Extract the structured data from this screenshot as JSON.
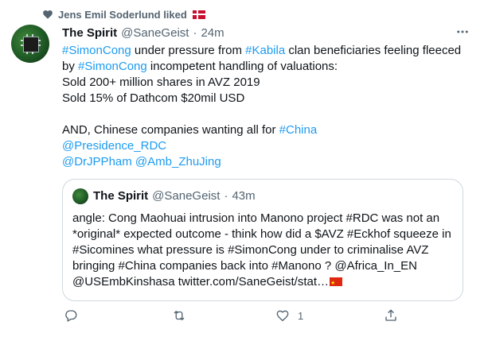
{
  "social_context": {
    "text": "Jens Emil Soderlund  liked",
    "flag": "denmark-flag"
  },
  "tweet": {
    "author_name": "The Spirit",
    "handle": "@SaneGeist",
    "separator": "·",
    "time": "24m",
    "lines": [
      [
        {
          "t": "#SimonCong",
          "k": "hashtag"
        },
        {
          "t": " under pressure from ",
          "k": "text"
        },
        {
          "t": "#Kabila",
          "k": "hashtag"
        },
        {
          "t": " clan beneficiaries feeling fleeced",
          "k": "text"
        }
      ],
      [
        {
          "t": "by ",
          "k": "text"
        },
        {
          "t": "#SimonCong",
          "k": "hashtag"
        },
        {
          "t": " incompetent handling of valuations:",
          "k": "text"
        }
      ],
      [
        {
          "t": "Sold 200+ million shares in AVZ 2019",
          "k": "text"
        }
      ],
      [
        {
          "t": "Sold 15% of Dathcom $20mil USD",
          "k": "text"
        }
      ],
      [
        {
          "t": "",
          "k": "text"
        }
      ],
      [
        {
          "t": "AND, Chinese companies wanting all for ",
          "k": "text"
        },
        {
          "t": "#China",
          "k": "hashtag"
        }
      ],
      [
        {
          "t": "@Presidence_RDC",
          "k": "mention"
        }
      ],
      [
        {
          "t": "@DrJPPham",
          "k": "mention"
        },
        {
          "t": " ",
          "k": "text"
        },
        {
          "t": "@Amb_ZhuJing",
          "k": "mention"
        }
      ]
    ]
  },
  "quote": {
    "author_name": "The Spirit",
    "handle": "@SaneGeist",
    "separator": "·",
    "time": "43m",
    "lines": [
      "angle: Cong Maohuai intrusion into Manono project #RDC was not an",
      "*original* expected outcome - think how did a $AVZ #Eckhof squeeze in",
      "#Sicomines what pressure is #SimonCong under to criminalise AVZ",
      "bringing #China  companies back into #Manono  ?  @Africa_In_EN",
      "@USEmbKinshasa twitter.com/SaneGeist/stat…"
    ],
    "trailing_flag": "china-flag"
  },
  "actions": {
    "reply_count": "",
    "retweet_count": "",
    "like_count": "1",
    "share_count": ""
  },
  "colors": {
    "link": "#1d9bf0",
    "secondary_text": "#536471",
    "border": "#cfd9de"
  }
}
